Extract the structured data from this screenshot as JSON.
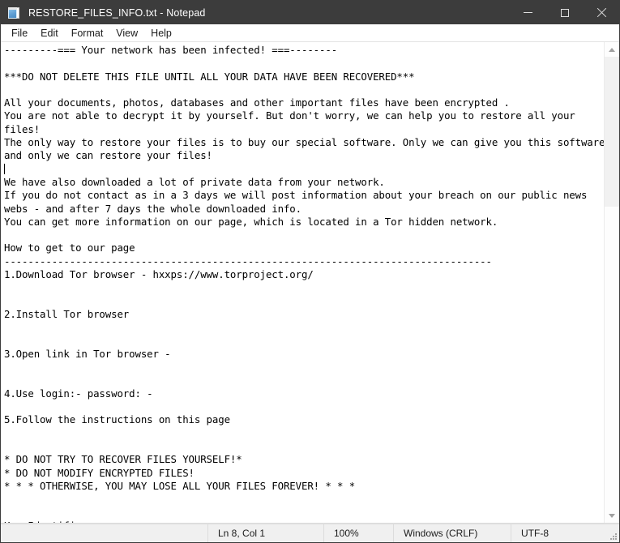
{
  "window": {
    "title": "RESTORE_FILES_INFO.txt - Notepad",
    "icon": "notepad-icon",
    "controls": {
      "minimize": "minimize-icon",
      "maximize": "maximize-icon",
      "close": "close-icon"
    }
  },
  "menubar": {
    "items": [
      {
        "label": "File"
      },
      {
        "label": "Edit"
      },
      {
        "label": "Format"
      },
      {
        "label": "View"
      },
      {
        "label": "Help"
      }
    ]
  },
  "document": {
    "filename": "RESTORE_FILES_INFO.txt",
    "lines": [
      "---------=== Your network has been infected! ===--------",
      "",
      "***DO NOT DELETE THIS FILE UNTIL ALL YOUR DATA HAVE BEEN RECOVERED***",
      "",
      "All your documents, photos, databases and other important files have been encrypted .",
      "You are not able to decrypt it by yourself. But don't worry, we can help you to restore all your",
      "files!",
      "The only way to restore your files is to buy our special software. Only we can give you this software",
      "and only we can restore your files!",
      "",
      "We have also downloaded a lot of private data from your network.",
      "If you do not contact as in a 3 days we will post information about your breach on our public news",
      "webs - and after 7 days the whole downloaded info.",
      "You can get more information on our page, which is located in a Tor hidden network.",
      "",
      "How to get to our page",
      "----------------------------------------------------------------------------------",
      "1.Download Tor browser - hxxps://www.torproject.org/",
      "",
      "",
      "2.Install Tor browser",
      "",
      "",
      "3.Open link in Tor browser - ",
      "",
      "",
      "4.Use login:- password: -",
      "",
      "5.Follow the instructions on this page",
      "",
      "",
      "* DO NOT TRY TO RECOVER FILES YOURSELF!*",
      "* DO NOT MODIFY ENCRYPTED FILES!",
      "* * * OTHERWISE, YOU MAY LOSE ALL YOUR FILES FOREVER! * * *",
      "",
      "",
      "Key Identifier:"
    ],
    "caret_after_line_index": 8
  },
  "scrollbar": {
    "up_arrow": "scroll-up-icon",
    "down_arrow": "scroll-down-icon",
    "thumb": "scroll-thumb"
  },
  "statusbar": {
    "cursor_position": "Ln 8, Col 1",
    "zoom": "100%",
    "line_ending": "Windows (CRLF)",
    "encoding": "UTF-8",
    "resize_grip": "resize-grip-icon"
  },
  "colors": {
    "titlebar_bg": "#3c3c3c",
    "titlebar_fg": "#ffffff",
    "editor_bg": "#ffffff",
    "editor_fg": "#000000",
    "statusbar_bg": "#f0f0f0",
    "close_hover": "#e81123"
  }
}
